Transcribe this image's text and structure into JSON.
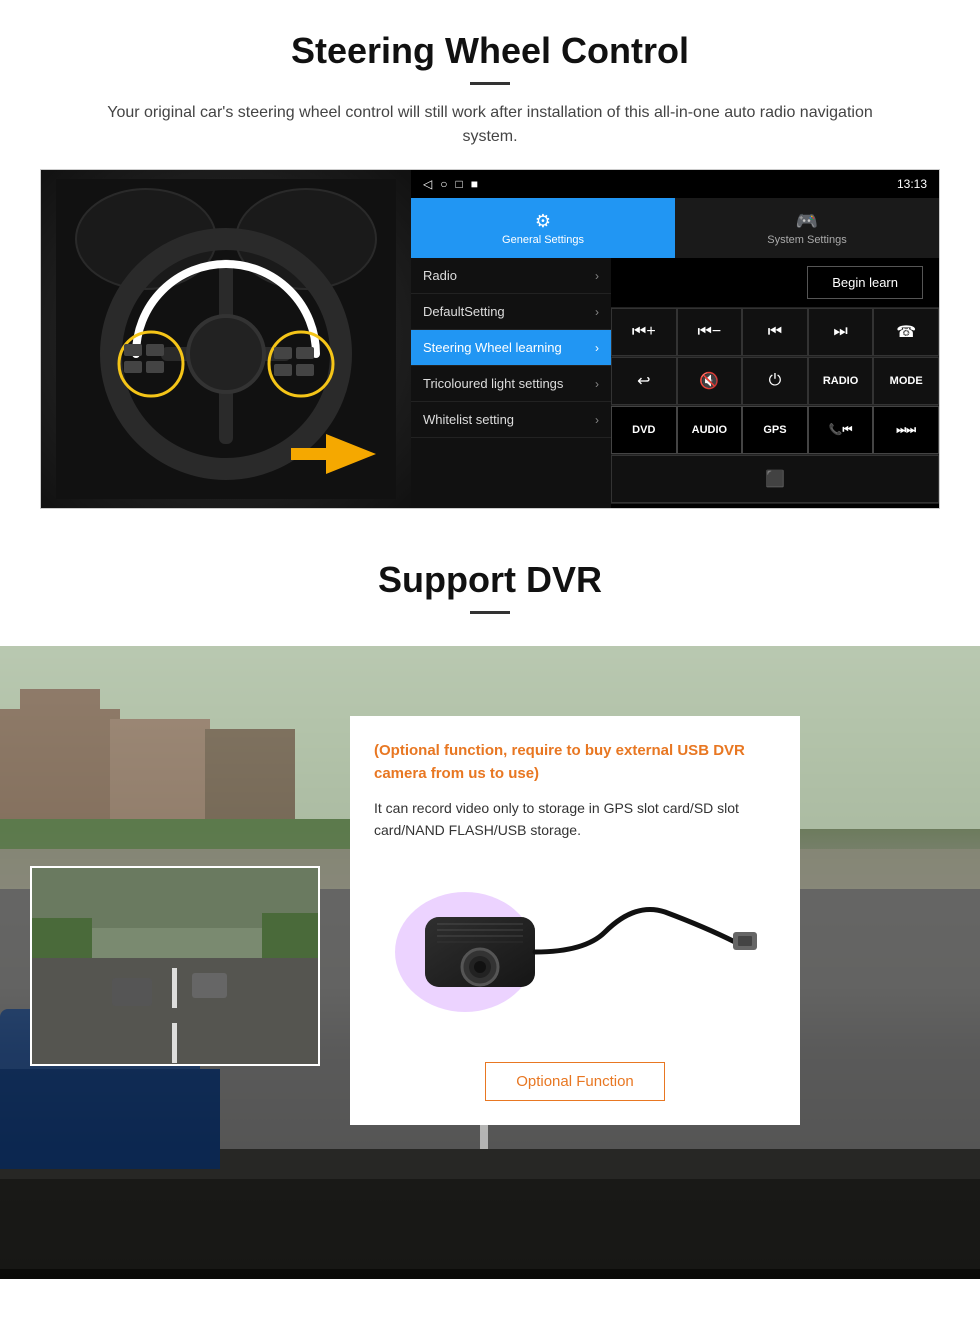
{
  "page": {
    "section1": {
      "title": "Steering Wheel Control",
      "subtitle": "Your original car's steering wheel control will still work after installation of this all-in-one auto radio navigation system.",
      "android_ui": {
        "statusbar": {
          "icons": [
            "◁",
            "○",
            "□",
            "■"
          ],
          "time": "13:13",
          "signal_icons": "▼"
        },
        "tabs": [
          {
            "label": "General Settings",
            "icon": "⚙",
            "active": true
          },
          {
            "label": "System Settings",
            "icon": "🎮",
            "active": false
          }
        ],
        "menu_items": [
          {
            "label": "Radio",
            "active": false
          },
          {
            "label": "DefaultSetting",
            "active": false
          },
          {
            "label": "Steering Wheel learning",
            "active": true
          },
          {
            "label": "Tricoloured light settings",
            "active": false
          },
          {
            "label": "Whitelist setting",
            "active": false
          }
        ],
        "begin_learn_label": "Begin learn",
        "control_buttons": [
          [
            "⏮+",
            "⏮−",
            "⏮",
            "⏭",
            "☎"
          ],
          [
            "↩",
            "🔇",
            "⏻",
            "RADIO",
            "MODE"
          ],
          [
            "DVD",
            "AUDIO",
            "GPS",
            "📞⏮",
            "⏭⏭"
          ]
        ]
      }
    },
    "section2": {
      "title": "Support DVR",
      "optional_title_text": "(Optional function, require to buy external USB DVR camera from us to use)",
      "description": "It can record video only to storage in GPS slot card/SD slot card/NAND FLASH/USB storage.",
      "optional_function_button": "Optional Function"
    }
  }
}
